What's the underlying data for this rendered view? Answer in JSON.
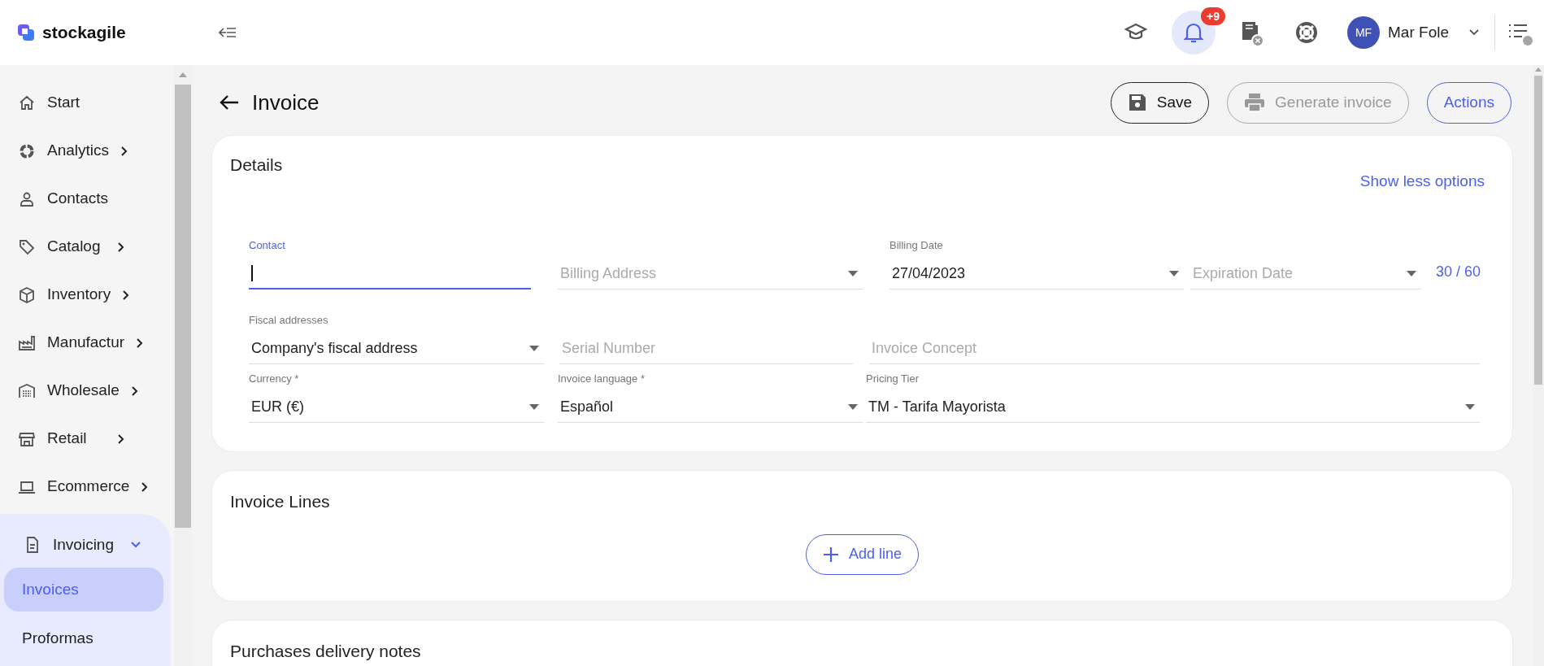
{
  "header": {
    "logo": "stockagile",
    "notifications_badge": "+9",
    "user": {
      "initials": "MF",
      "name": "Mar Fole"
    }
  },
  "sidebar": {
    "items": [
      {
        "label": "Start",
        "has_submenu": false,
        "expanded": false
      },
      {
        "label": "Analytics",
        "has_submenu": true,
        "expanded": false
      },
      {
        "label": "Contacts",
        "has_submenu": false,
        "expanded": false
      },
      {
        "label": "Catalog",
        "has_submenu": true,
        "expanded": false
      },
      {
        "label": "Inventory",
        "has_submenu": true,
        "expanded": false
      },
      {
        "label": "Manufactur",
        "has_submenu": true,
        "expanded": false
      },
      {
        "label": "Wholesale",
        "has_submenu": true,
        "expanded": false
      },
      {
        "label": "Retail",
        "has_submenu": true,
        "expanded": false
      },
      {
        "label": "Ecommerce",
        "has_submenu": true,
        "expanded": false
      },
      {
        "label": "Invoicing",
        "has_submenu": true,
        "expanded": true,
        "children": [
          {
            "label": "Invoices",
            "selected": true
          },
          {
            "label": "Proformas",
            "selected": false
          }
        ]
      }
    ]
  },
  "page": {
    "title": "Invoice",
    "buttons": [
      {
        "label": "Save",
        "kind": "save",
        "disabled": false
      },
      {
        "label": "Generate invoice",
        "kind": "print",
        "disabled": true
      },
      {
        "label": "Actions",
        "kind": "plain",
        "disabled": false
      }
    ]
  },
  "details": {
    "title": "Details",
    "toggle_link": "Show less options",
    "rows": [
      [
        {
          "label": "Contact",
          "kind": "text",
          "focused": true
        },
        {
          "placeholder": "Billing Address",
          "kind": "select",
          "focused": false
        },
        {
          "label": "Billing Date",
          "value": "27/04/2023",
          "kind": "select",
          "focused": false
        },
        {
          "placeholder": "Expiration Date",
          "kind": "select",
          "focused": false
        }
      ],
      [
        {
          "label": "Fiscal addresses",
          "value": "Company's fiscal address",
          "kind": "select",
          "focused": false
        },
        {
          "placeholder": "Serial Number",
          "kind": "text",
          "focused": false
        },
        {
          "placeholder": "Invoice Concept",
          "kind": "text",
          "focused": false
        }
      ],
      [
        {
          "label": "Currency *",
          "value": "EUR (€)",
          "kind": "select",
          "focused": false
        },
        {
          "label": "Invoice language *",
          "value": "Español",
          "kind": "select",
          "focused": false
        },
        {
          "label": "Pricing Tier",
          "value": "TM - Tarifa Mayorista",
          "kind": "select",
          "focused": false
        }
      ]
    ],
    "days_counter": "30 / 60"
  },
  "invoice_lines": {
    "title": "Invoice Lines",
    "add_button": "Add line"
  },
  "delivery_notes": {
    "title": "Purchases delivery notes"
  }
}
